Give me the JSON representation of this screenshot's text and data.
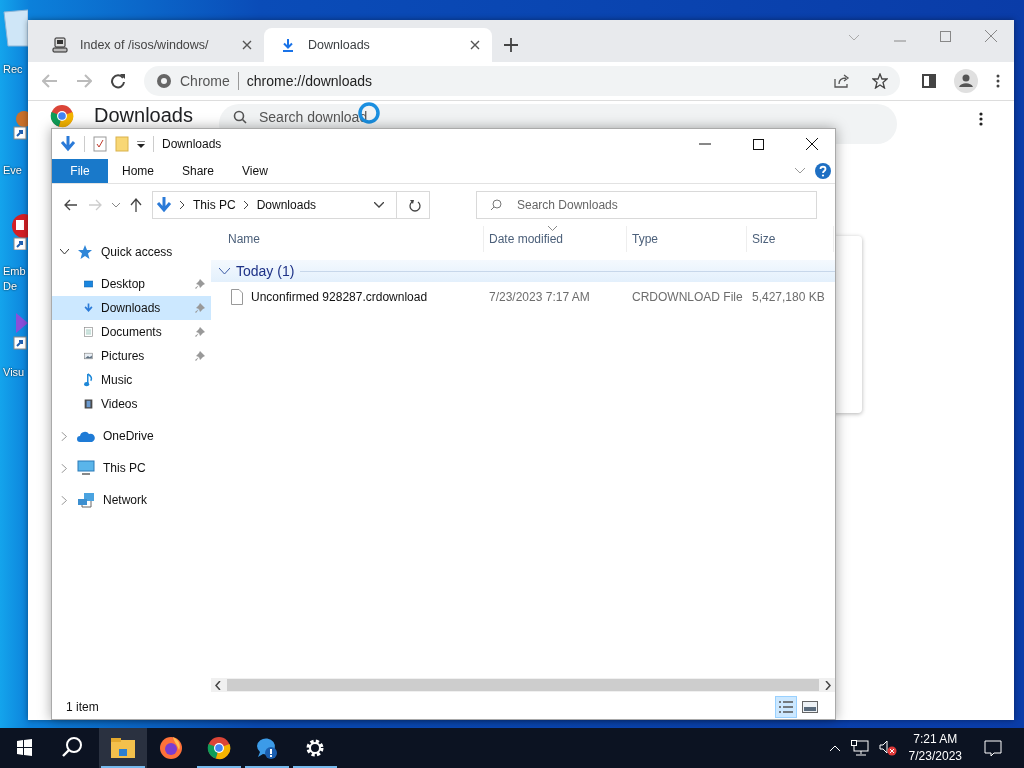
{
  "desktop_icons": [
    {
      "kind": "recycle",
      "label_lines": [
        "Rec"
      ]
    },
    {
      "kind": "shortcut",
      "label_lines": [
        "Eve"
      ]
    },
    {
      "kind": "app",
      "label_lines": [
        "Emb",
        "De"
      ]
    },
    {
      "kind": "media",
      "label_lines": [
        "Visu"
      ]
    }
  ],
  "browser": {
    "tabs": [
      {
        "kind": "server",
        "title": "Index of /isos/windows/",
        "selected": false
      },
      {
        "kind": "download",
        "title": "Downloads",
        "selected": true
      }
    ],
    "omnibox": {
      "chip": "Chrome",
      "url": "chrome://downloads"
    },
    "page": {
      "heading": "Downloads",
      "search": {
        "placeholder": "Search download"
      }
    }
  },
  "explorer": {
    "title": "Downloads",
    "ribbon_tabs": [
      {
        "label": "File",
        "selected": true
      },
      {
        "label": "Home",
        "selected": false
      },
      {
        "label": "Share",
        "selected": false
      },
      {
        "label": "View",
        "selected": false
      }
    ],
    "breadcrumb": [
      "This PC",
      "Downloads"
    ],
    "search": {
      "placeholder": "Search Downloads"
    },
    "nav": [
      {
        "kind": "quick",
        "label": "Quick access",
        "expanded": true,
        "selected": false,
        "children": [
          {
            "kind": "desktop",
            "label": "Desktop",
            "pinned": true,
            "selected": false
          },
          {
            "kind": "downloads",
            "label": "Downloads",
            "pinned": true,
            "selected": true
          },
          {
            "kind": "documents",
            "label": "Documents",
            "pinned": true,
            "selected": false
          },
          {
            "kind": "pictures",
            "label": "Pictures",
            "pinned": true,
            "selected": false
          },
          {
            "kind": "music",
            "label": "Music",
            "pinned": false,
            "selected": false
          },
          {
            "kind": "videos",
            "label": "Videos",
            "pinned": false,
            "selected": false
          }
        ]
      },
      {
        "kind": "cloud",
        "label": "OneDrive",
        "expanded": false,
        "selected": false
      },
      {
        "kind": "pc",
        "label": "This PC",
        "expanded": false,
        "selected": false
      },
      {
        "kind": "network",
        "label": "Network",
        "expanded": false,
        "selected": false
      }
    ],
    "columns": [
      {
        "label": "Name",
        "sorted": false
      },
      {
        "label": "Date modified",
        "sorted": true
      },
      {
        "label": "Type",
        "sorted": false
      },
      {
        "label": "Size",
        "sorted": false
      }
    ],
    "groups": [
      {
        "label": "Today (1)",
        "expanded": true,
        "files": [
          {
            "name": "Unconfirmed 928287.crdownload",
            "date": "7/23/2023 7:17 AM",
            "type": "CRDOWNLOAD File",
            "size": "5,427,180 KB"
          }
        ]
      }
    ],
    "status": "1 item",
    "view_modes": [
      {
        "kind": "details",
        "selected": true
      },
      {
        "kind": "tiles",
        "selected": false
      }
    ]
  },
  "taskbar": {
    "apps": [
      {
        "kind": "explorer",
        "active": true,
        "running": true
      },
      {
        "kind": "firefox",
        "active": false,
        "running": false
      },
      {
        "kind": "chrome",
        "active": false,
        "running": true
      },
      {
        "kind": "help",
        "active": false,
        "running": true
      },
      {
        "kind": "settings",
        "active": false,
        "running": true
      }
    ],
    "tray": {
      "volume_muted": true,
      "time": "7:21 AM",
      "date": "7/23/2023"
    }
  }
}
